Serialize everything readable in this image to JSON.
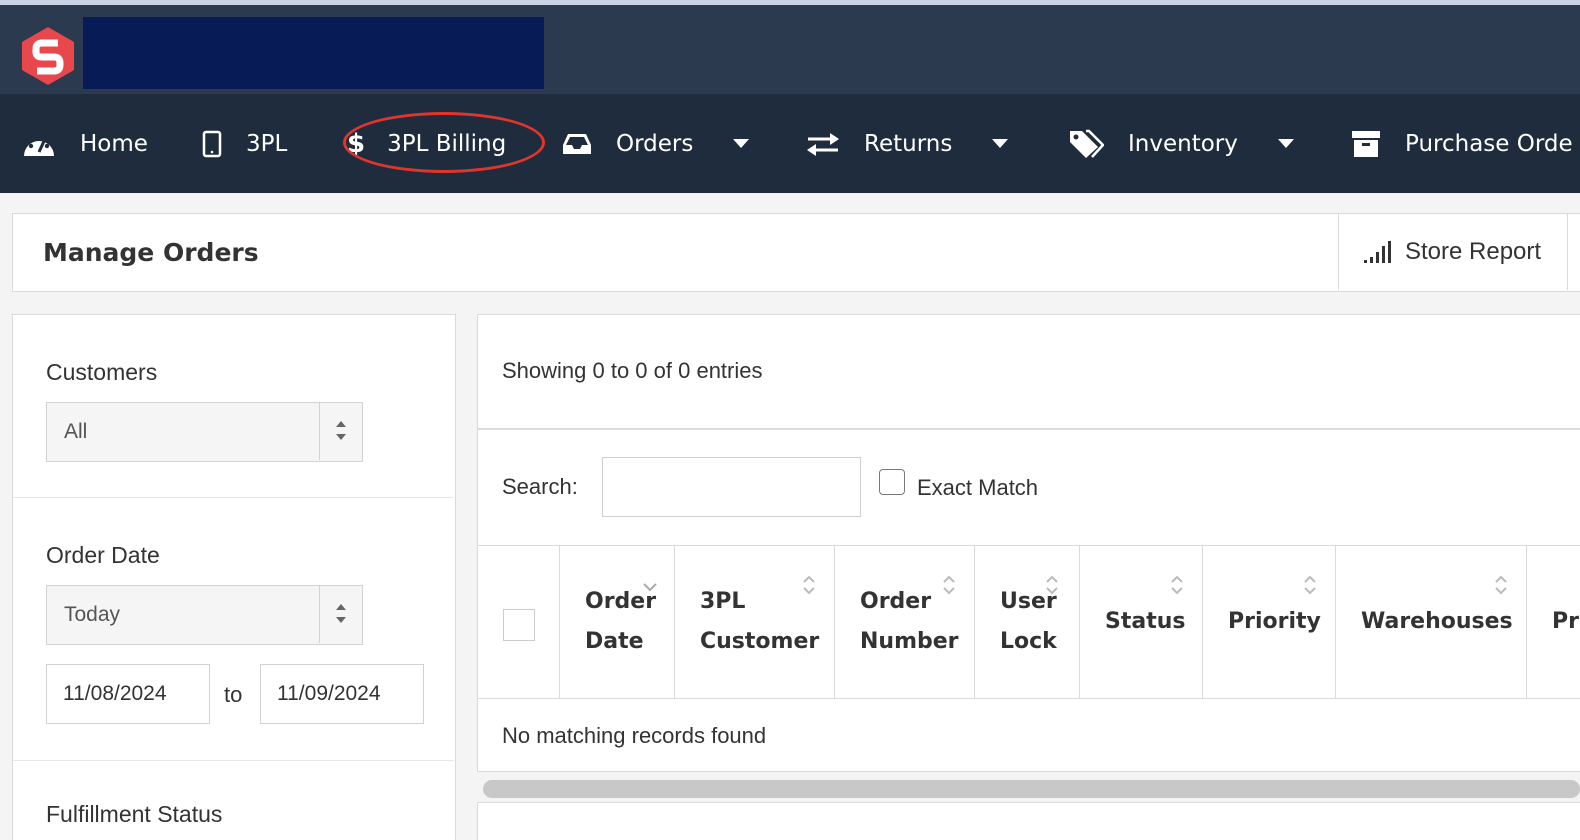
{
  "brand": {
    "logo_letter": "S",
    "logo_color": "#e8484c"
  },
  "nav": {
    "items": [
      {
        "label": "Home",
        "icon": "dashboard-gauge-icon"
      },
      {
        "label": "3PL",
        "icon": "tablet-icon"
      },
      {
        "label": "3PL Billing",
        "icon": "dollar-icon",
        "icon_glyph": "$",
        "highlighted": true
      },
      {
        "label": "Orders",
        "icon": "inbox-tray-icon"
      },
      {
        "label": "Returns",
        "icon": "exchange-arrows-icon"
      },
      {
        "label": "Inventory",
        "icon": "tags-icon"
      },
      {
        "label": "Purchase Orde",
        "icon": "archive-box-icon"
      }
    ],
    "highlight_color": "#e0352b"
  },
  "header": {
    "title": "Manage Orders",
    "store_report_label": "Store Report"
  },
  "filters": {
    "customers": {
      "label": "Customers",
      "value": "All"
    },
    "order_date": {
      "label": "Order Date",
      "value": "Today",
      "from": "11/08/2024",
      "to_label": "to",
      "to": "11/09/2024"
    },
    "fulfillment_status": {
      "label": "Fulfillment Status"
    }
  },
  "results": {
    "showing_text": "Showing 0 to 0 of 0 entries",
    "search_label": "Search:",
    "search_value": "",
    "exact_match_label": "Exact Match",
    "columns": [
      {
        "line1": "Order",
        "line2": "Date"
      },
      {
        "line1": "3PL",
        "line2": "Customer"
      },
      {
        "line1": "Order",
        "line2": "Number"
      },
      {
        "line1": "User",
        "line2": "Lock"
      },
      {
        "line1": "Status",
        "line2": ""
      },
      {
        "line1": "Priority",
        "line2": ""
      },
      {
        "line1": "Warehouses",
        "line2": ""
      },
      {
        "line1": "Pr",
        "line2": ""
      }
    ],
    "empty_text": "No matching records found"
  },
  "colors": {
    "brandbar": "#2c3a4f",
    "navbar": "#1f2c3e",
    "redaction": "#071c56"
  }
}
